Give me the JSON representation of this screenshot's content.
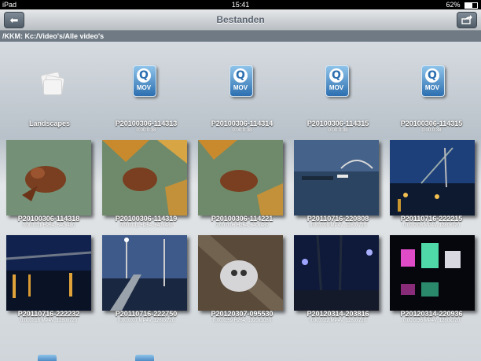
{
  "status": {
    "device": "iPad",
    "time": "15:41",
    "battery": "62%"
  },
  "nav": {
    "title": "Bestanden",
    "back_icon": "arrow-left-icon",
    "share_icon": "share-icon"
  },
  "path": "/KKM: Kc:/Video's/Alle video's",
  "row1": [
    {
      "type": "folder",
      "name": "Landscapes",
      "meta": ""
    },
    {
      "type": "mov",
      "name": "P20100306-114313",
      "meta": "0:00:0:38",
      "ext": "MOV"
    },
    {
      "type": "mov",
      "name": "P20100306-114314",
      "meta": "0:00:0:38",
      "ext": "MOV"
    },
    {
      "type": "mov",
      "name": "P20100306-114315",
      "meta": "0:00:0:38",
      "ext": "MOV"
    },
    {
      "type": "mov",
      "name": "P20100306-114315",
      "meta": "0:00:0:38",
      "ext": "MOV"
    }
  ],
  "row2": [
    {
      "name": "P20100306-114318",
      "meta": "0:00:0:11 H264, 640x480",
      "scene": "toad"
    },
    {
      "name": "P20100306-114319",
      "meta": "0:00:0:11 H264, 640x480",
      "scene": "toad-leaves"
    },
    {
      "name": "P20100306-114221",
      "meta": "0:00:0:06 H264, 640x480",
      "scene": "toad-leaves"
    },
    {
      "name": "P20110716-220808",
      "meta": "0:00:0:09 MP4V, 1280x720",
      "scene": "bridge-dusk"
    },
    {
      "name": "P20110716-222215",
      "meta": "0:00:0:08 MP4V, 1280x720",
      "scene": "harbor-night"
    }
  ],
  "row3": [
    {
      "name": "P20110716-222232",
      "meta": "0:00:0:18 MP4V, 1280x720",
      "scene": "bridge-night"
    },
    {
      "name": "P20110716-222750",
      "meta": "0:00:0:07 MP4V, 1280x720",
      "scene": "pier-night"
    },
    {
      "name": "P20120307-095530",
      "meta": "0:00:0:59 H264, 1920x1080",
      "scene": "cat"
    },
    {
      "name": "P20120314-203816",
      "meta": "0:00:0:22 MP4V, 1280x720",
      "scene": "park-night"
    },
    {
      "name": "P20120314-220936",
      "meta": "0:00:0:36 MP4V, 1280x720",
      "scene": "city-lights"
    }
  ]
}
